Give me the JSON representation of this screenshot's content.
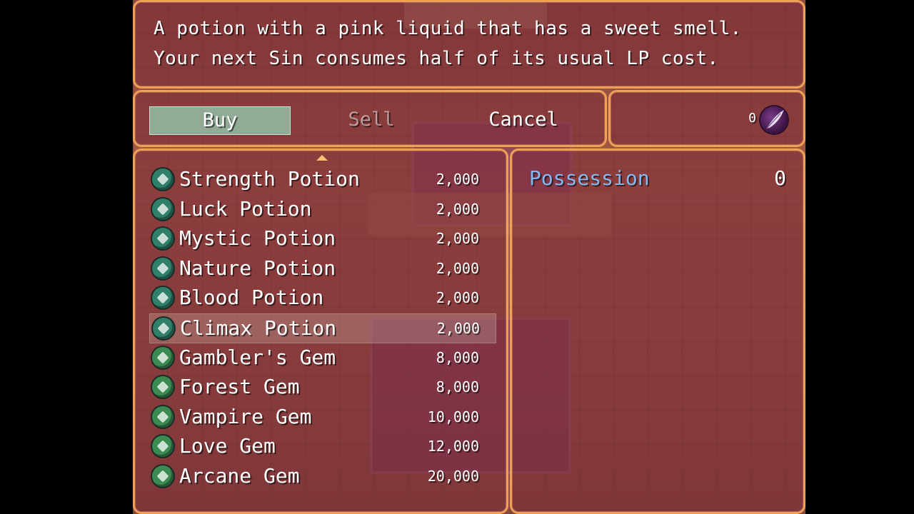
{
  "description": {
    "line1": "A potion with a pink liquid that has a sweet smell.",
    "line2": "Your next Sin consumes half of its usual LP cost."
  },
  "commands": {
    "buy": "Buy",
    "sell": "Sell",
    "cancel": "Cancel",
    "selected": "Buy"
  },
  "gold": {
    "value": "0",
    "icon": "feather-orb-icon"
  },
  "items": [
    {
      "name": "Strength Potion",
      "price": "2,000",
      "icon": "strength-potion-icon",
      "color": "#2f7f6a"
    },
    {
      "name": "Luck Potion",
      "price": "2,000",
      "icon": "luck-potion-icon",
      "color": "#2f7f6a"
    },
    {
      "name": "Mystic Potion",
      "price": "2,000",
      "icon": "mystic-potion-icon",
      "color": "#2f7f6a"
    },
    {
      "name": "Nature Potion",
      "price": "2,000",
      "icon": "nature-potion-icon",
      "color": "#2f7f6a"
    },
    {
      "name": "Blood Potion",
      "price": "2,000",
      "icon": "blood-potion-icon",
      "color": "#2f7f6a"
    },
    {
      "name": "Climax Potion",
      "price": "2,000",
      "icon": "climax-potion-icon",
      "color": "#2f7f6a"
    },
    {
      "name": "Gambler's Gem",
      "price": "8,000",
      "icon": "gamblers-gem-icon",
      "color": "#3a8a52"
    },
    {
      "name": "Forest Gem",
      "price": "8,000",
      "icon": "forest-gem-icon",
      "color": "#3a8a52"
    },
    {
      "name": "Vampire Gem",
      "price": "10,000",
      "icon": "vampire-gem-icon",
      "color": "#3a8a52"
    },
    {
      "name": "Love Gem",
      "price": "12,000",
      "icon": "love-gem-icon",
      "color": "#3a8a52"
    },
    {
      "name": "Arcane Gem",
      "price": "20,000",
      "icon": "arcane-gem-icon",
      "color": "#3a8a52"
    }
  ],
  "selected_item": "Climax Potion",
  "status": {
    "possession_label": "Possession",
    "possession_value": "0"
  },
  "colors": {
    "window_border": "#f0a055",
    "highlight": "#96e6c8",
    "system_text": "#84b8f0"
  }
}
